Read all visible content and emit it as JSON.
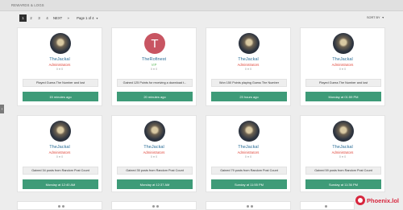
{
  "header": {
    "title": "REWARDS & LOGS"
  },
  "pagination": {
    "pages": [
      "1",
      "2",
      "3",
      "4"
    ],
    "next_label": "NEXT",
    "last_label": "»",
    "info": "Page 1 of 4",
    "sort_label": "SORT BY"
  },
  "cards": [
    {
      "username": "TheJackal",
      "role": "Administrators",
      "meta": "0 ● 0",
      "description": "Played Guess The Number and lost",
      "time": "15 minutes ago",
      "avatar": "image"
    },
    {
      "username": "TheRofinest",
      "role": "VIP",
      "meta": "0 ● 0",
      "description": "Gained 125 Points for receiving a download t...",
      "time": "20 minutes ago",
      "avatar": "letter",
      "avatar_letter": "T"
    },
    {
      "username": "TheJackal",
      "role": "Administrators",
      "meta": "0 ● 0",
      "description": "Won 150 Points playing Guess The Number",
      "time": "23 hours ago",
      "avatar": "image"
    },
    {
      "username": "TheJackal",
      "role": "Administrators",
      "meta": "0 ● 0",
      "description": "Played Guess The Number and lost",
      "time": "Monday at 01:59 PM",
      "avatar": "image"
    },
    {
      "username": "TheJackal",
      "role": "Administrators",
      "meta": "0 ● 0",
      "description": "Gained 34 posts from Random Post Count",
      "time": "Monday at 12:40 AM",
      "avatar": "image"
    },
    {
      "username": "TheJackal",
      "role": "Administrators",
      "meta": "0 ● 0",
      "description": "Gained 35 posts from Random Post Count",
      "time": "Monday at 12:37 AM",
      "avatar": "image"
    },
    {
      "username": "TheJackal",
      "role": "Administrators",
      "meta": "0 ● 0",
      "description": "Gained 79 posts from Random Post Count",
      "time": "Sunday at 11:55 PM",
      "avatar": "image"
    },
    {
      "username": "TheJackal",
      "role": "Administrators",
      "meta": "0 ● 0",
      "description": "Gained 59 posts from Random Post Count",
      "time": "Sunday at 11:36 PM",
      "avatar": "image"
    }
  ],
  "logo": {
    "text": "Phoenix.lol"
  },
  "colors": {
    "accent_green": "#3e9b78",
    "admin_red": "#e0473b",
    "vip_green": "#6cbf6a",
    "name_blue": "#2c6e97"
  }
}
